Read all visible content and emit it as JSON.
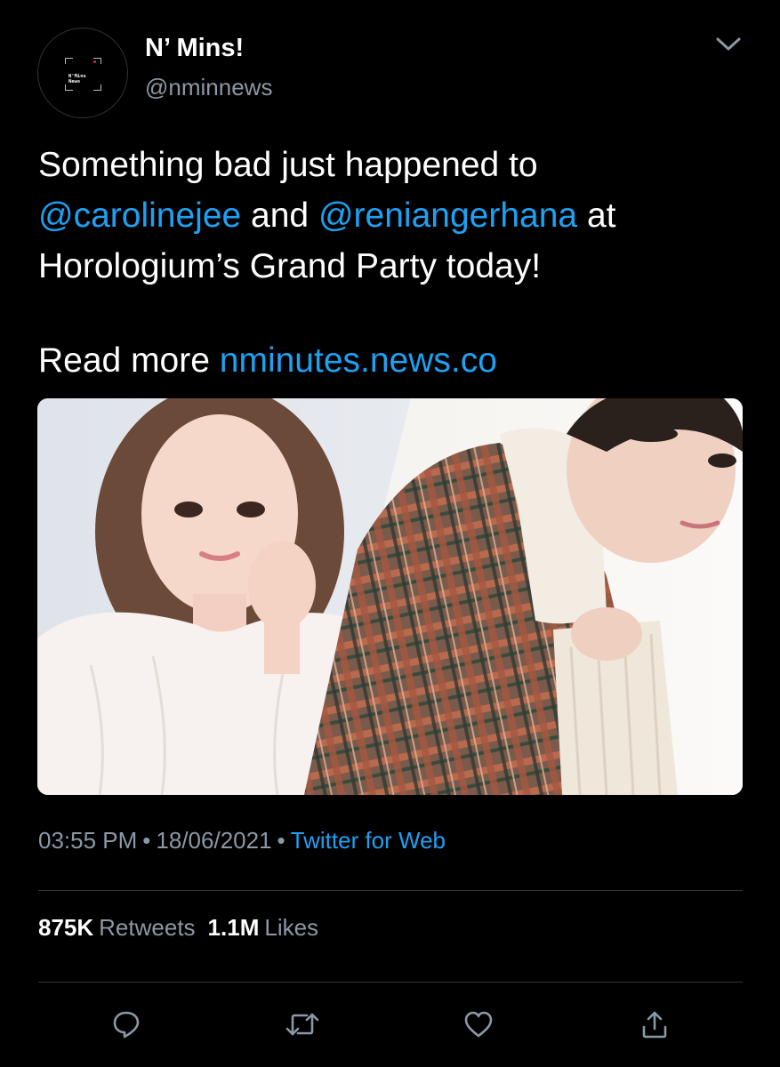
{
  "header": {
    "display_name": "N’ Mins!",
    "handle": "@nminnews",
    "avatar_text": "N'Mins\nNews",
    "menu_icon": "chevron-down-icon"
  },
  "tweet": {
    "line1": "Something bad just happened to",
    "mention1": "@carolinejee",
    "and_text": " and ",
    "mention2": "@reniangerhana",
    "at_text": " at",
    "line3": "Horologium’s Grand Party today!",
    "read_more": "Read more ",
    "link": "nminutes.news.co"
  },
  "meta": {
    "time": "03:55 PM",
    "separator": "•",
    "date": "18/06/2021",
    "source": "Twitter for Web"
  },
  "stats": {
    "retweets_count": "875K",
    "retweets_label": "Retweets",
    "likes_count": "1.1M",
    "likes_label": "Likes"
  },
  "actions": [
    "reply-icon",
    "retweet-icon",
    "like-icon",
    "share-icon"
  ],
  "colors": {
    "background": "#000000",
    "link": "#1da1f2",
    "secondary_text": "#8b98a5",
    "divider": "#2f3336"
  }
}
